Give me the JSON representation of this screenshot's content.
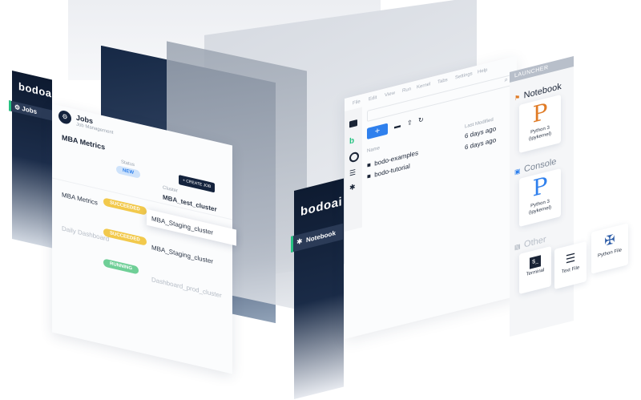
{
  "left_panel": {
    "logo": "bodoai",
    "nav_jobs": "Jobs",
    "title": "Jobs",
    "subtitle": "Job Management",
    "featured_job": "MBA Metrics",
    "status_header": "Status",
    "new_badge": "NEW",
    "create_button": "+ CREATE JOB",
    "cluster_header": "Cluster",
    "clusters": [
      "MBA_test_cluster",
      "MBA_Staging_cluster",
      "MBA_Staging_cluster",
      "Dashboard_prod_cluster"
    ],
    "rows": [
      {
        "name": "MBA Metrics",
        "status": "SUCCEEDED",
        "status_color": "#f2c94c"
      },
      {
        "name": "Daily Dashboard",
        "status": "SUCCEEDED",
        "status_color": "#f2c94c"
      },
      {
        "name": "",
        "status": "RUNNING",
        "status_color": "#6fcf97"
      }
    ]
  },
  "right_panel": {
    "logo": "bodoai",
    "nav_notebook": "Notebook",
    "menu": [
      "File",
      "Edit",
      "View",
      "Run",
      "Kernel",
      "Tabs",
      "Settings",
      "Help"
    ],
    "new_button": "+",
    "col_name": "Name",
    "col_modified": "Last Modified",
    "files": [
      {
        "name": "bodo-examples",
        "modified": "6 days ago"
      },
      {
        "name": "bodo-tutorial",
        "modified": "6 days ago"
      }
    ]
  },
  "launcher": {
    "header": "LAUNCHER",
    "sections": {
      "notebook": "Notebook",
      "console": "Console",
      "other": "Other"
    },
    "cards": {
      "python3_notebook": "Python 3 (ipykernel)",
      "python3_console": "Python 3 (ipykernel)",
      "terminal": "Terminal",
      "text_file": "Text File",
      "python_file": "Python File"
    }
  },
  "colors": {
    "navy": "#0e1b31",
    "accent_green": "#26c281",
    "jupyter_orange": "#e07b26",
    "new_blue": "#2f80ed"
  }
}
